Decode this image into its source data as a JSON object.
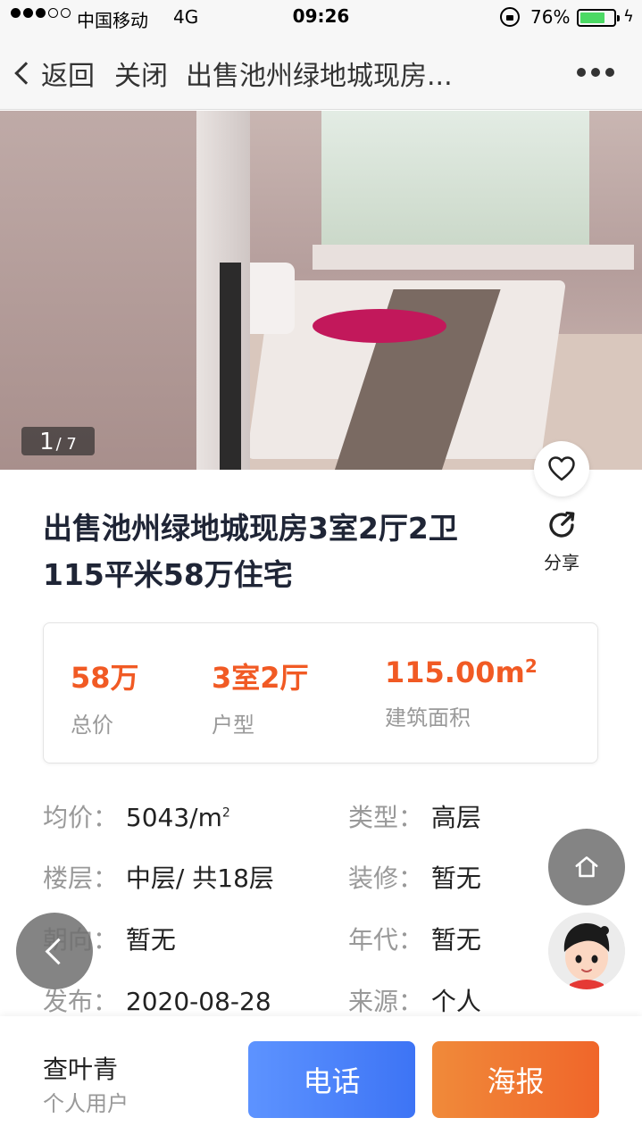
{
  "status_bar": {
    "carrier": "中国移动",
    "network": "4G",
    "time": "09:26",
    "battery_percent": "76%",
    "battery_level": 0.76
  },
  "nav": {
    "back_label": "返回",
    "close_label": "关闭",
    "title": "出售池州绿地城现房..."
  },
  "photo": {
    "current": "1",
    "total": "/ 7"
  },
  "listing": {
    "title_line1": "出售池州绿地城现房3室2厅2卫",
    "title_line2": "115平米58万住宅",
    "share_label": "分享"
  },
  "summary": [
    {
      "value": "58万",
      "label": "总价"
    },
    {
      "value": "3室2厅",
      "label": "户型"
    },
    {
      "value": "115.00m",
      "sup": "2",
      "label": "建筑面积"
    }
  ],
  "details": {
    "unit_price": {
      "key": "均价：",
      "value": "5043/m",
      "sup": "2"
    },
    "type": {
      "key": "类型：",
      "value": "高层"
    },
    "floor": {
      "key": "楼层：",
      "value": "中层/ 共18层"
    },
    "decoration": {
      "key": "装修：",
      "value": "暂无"
    },
    "orientation": {
      "key": "朝向：",
      "value": "暂无"
    },
    "year": {
      "key": "年代：",
      "value": "暂无"
    },
    "published": {
      "key": "发布：",
      "value": "2020-08-28"
    },
    "source": {
      "key": "来源：",
      "value": "个人"
    }
  },
  "agent": {
    "name": "查叶青",
    "role": "个人用户"
  },
  "actions": {
    "call_label": "电话",
    "poster_label": "海报"
  },
  "colors": {
    "accent_orange": "#f15a24",
    "call_blue": "#3d74f5",
    "poster_orange": "#f0662a"
  }
}
